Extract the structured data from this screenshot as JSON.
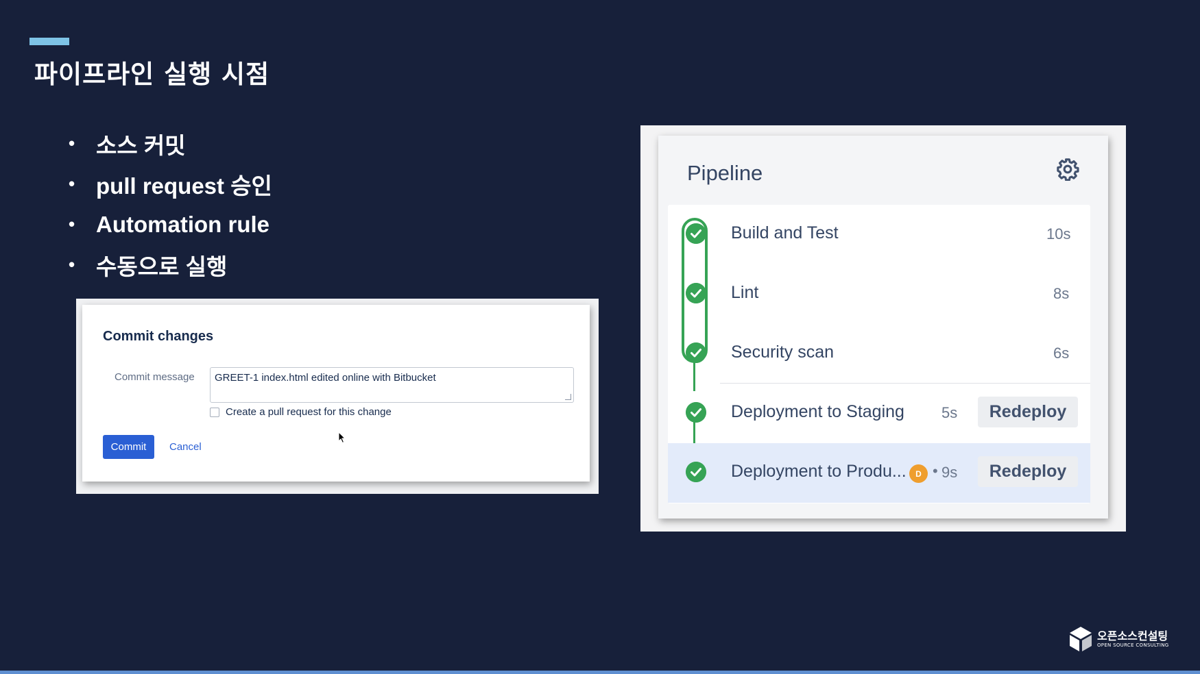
{
  "slide": {
    "title": "파이프라인 실행 시점",
    "bullets": [
      "소스 커밋",
      "pull request 승인",
      "Automation rule",
      "수동으로 실행"
    ],
    "bullet_char": "•"
  },
  "commit_dialog": {
    "title": "Commit changes",
    "message_label": "Commit message",
    "message_value": "GREET-1 index.html edited online with Bitbucket",
    "pr_checkbox_label": "Create a pull request for this change",
    "pr_checkbox_checked": false,
    "commit_button": "Commit",
    "cancel_link": "Cancel"
  },
  "pipeline": {
    "title": "Pipeline",
    "steps": [
      {
        "name": "Build and Test",
        "duration": "10s",
        "status": "success"
      },
      {
        "name": "Lint",
        "duration": "8s",
        "status": "success"
      },
      {
        "name": "Security scan",
        "duration": "6s",
        "status": "success"
      },
      {
        "name": "Deployment to Staging",
        "duration": "5s",
        "status": "success",
        "action": "Redeploy"
      },
      {
        "name": "Deployment to Produ...",
        "duration": "9s",
        "status": "success",
        "avatar": "D",
        "separator": "•",
        "action": "Redeploy"
      }
    ]
  },
  "logo": {
    "name_ko": "오픈소스컨설팅",
    "name_en": "OPEN SOURCE CONSULTING"
  },
  "colors": {
    "background": "#17203a",
    "accent": "#7ec3e6",
    "success": "#36a355",
    "primary_button": "#2a5fd4",
    "avatar": "#ef9e2e",
    "active_row": "#e3ebfa"
  }
}
